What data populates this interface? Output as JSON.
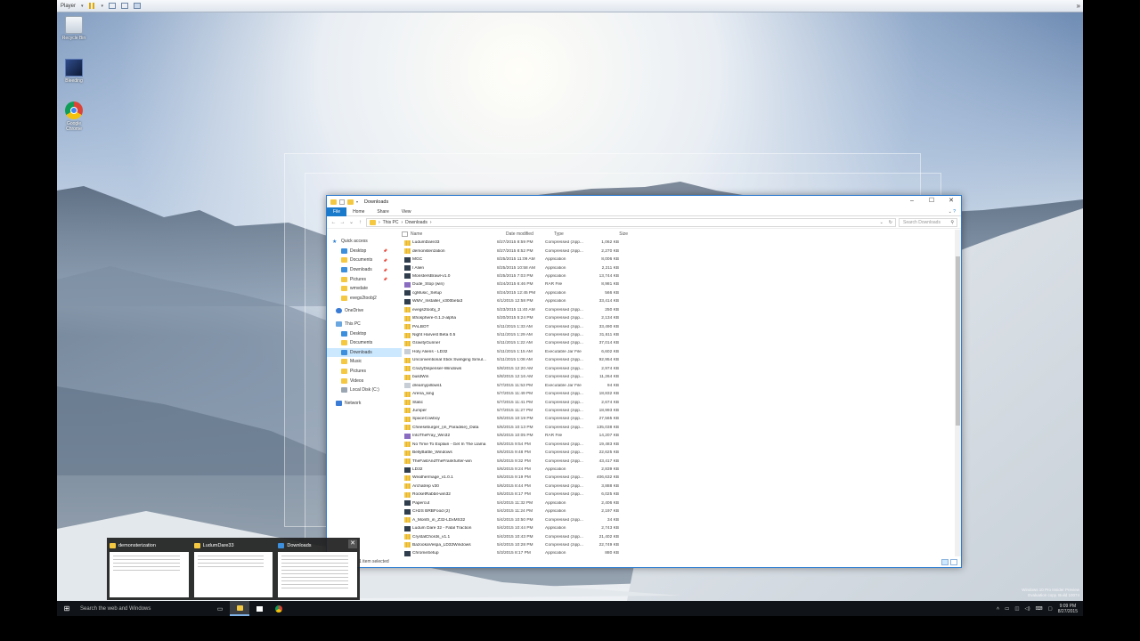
{
  "player": {
    "label": "Player"
  },
  "desktop": {
    "icons": [
      {
        "label": "Recycle Bin"
      },
      {
        "label": "Bleeding"
      },
      {
        "label": "Google Chrome"
      }
    ],
    "watermark": [
      "Windows 10 Pro Insider Preview",
      "Evaluation copy. Build 10074"
    ]
  },
  "explorer": {
    "title": "Downloads",
    "ribbon": {
      "tabs": [
        "File",
        "Home",
        "Share",
        "View"
      ]
    },
    "address": {
      "crumbs": [
        "This PC",
        "Downloads"
      ],
      "search_placeholder": "Search Downloads"
    },
    "nav": {
      "quick_access": "Quick access",
      "pinned": [
        "Desktop",
        "Documents",
        "Downloads",
        "Pictures"
      ],
      "recent": [
        "wmvdate",
        "evegs2toobj2"
      ],
      "onedrive": "OneDrive",
      "this_pc": "This PC",
      "pc_items": [
        "Desktop",
        "Documents",
        "Downloads",
        "Music",
        "Pictures",
        "Videos",
        "Local Disk (C:)"
      ],
      "network": "Network"
    },
    "columns": {
      "name": "Name",
      "date": "Date modified",
      "type": "Type",
      "size": "Size"
    },
    "files": [
      {
        "name": "LudumDare33",
        "date": "8/27/2015 8:59 PM",
        "type": "Compressed (zipp...",
        "size": "1,062 KB",
        "icon": "zip"
      },
      {
        "name": "demonsterization",
        "date": "8/27/2015 8:52 PM",
        "type": "Compressed (zipp...",
        "size": "2,270 KB",
        "icon": "zip"
      },
      {
        "name": "MGC",
        "date": "8/25/2015 11:09 AM",
        "type": "Application",
        "size": "8,006 KB",
        "icon": "exe"
      },
      {
        "name": "I Alien",
        "date": "8/25/2015 10:58 AM",
        "type": "Application",
        "size": "2,211 KB",
        "icon": "exe"
      },
      {
        "name": "MonstersBrawl-v1.0",
        "date": "8/25/2015 7:03 PM",
        "type": "Application",
        "size": "13,744 KB",
        "icon": "exe"
      },
      {
        "name": "Dude_Stop (win)",
        "date": "8/24/2015 6:46 PM",
        "type": "RAR File",
        "size": "8,981 KB",
        "icon": "rar"
      },
      {
        "name": "cgMusic_Setup",
        "date": "8/24/2015 12:45 PM",
        "type": "Application",
        "size": "566 KB",
        "icon": "exe"
      },
      {
        "name": "WMV_Installer_v300beta3",
        "date": "6/1/2015 12:58 PM",
        "type": "Application",
        "size": "33,414 KB",
        "icon": "exe"
      },
      {
        "name": "evegs2toobj_2",
        "date": "5/23/2015 11:40 AM",
        "type": "Compressed (zipp...",
        "size": "250 KB",
        "icon": "zip"
      },
      {
        "name": "lithosphere-0.1.2-alpha",
        "date": "5/20/2015 5:24 PM",
        "type": "Compressed (zipp...",
        "size": "2,134 KB",
        "icon": "zip"
      },
      {
        "name": "PALBOT",
        "date": "5/11/2015 1:33 AM",
        "type": "Compressed (zipp...",
        "size": "33,490 KB",
        "icon": "zip"
      },
      {
        "name": "Night Harvest Beta 0.5",
        "date": "5/11/2015 1:29 AM",
        "type": "Compressed (zipp...",
        "size": "31,611 KB",
        "icon": "zip"
      },
      {
        "name": "GravityGunner",
        "date": "5/11/2015 1:22 AM",
        "type": "Compressed (zipp...",
        "size": "37,014 KB",
        "icon": "zip"
      },
      {
        "name": "Holy Aliens - LD32",
        "date": "5/11/2015 1:15 AM",
        "type": "Executable Jar File",
        "size": "6,602 KB",
        "icon": "jar"
      },
      {
        "name": "Unconventional Stick Swinging Simul...",
        "date": "5/11/2015 1:08 AM",
        "type": "Compressed (zipp...",
        "size": "92,954 KB",
        "icon": "zip"
      },
      {
        "name": "CrazyDispenser-Windows",
        "date": "5/8/2015 12:20 AM",
        "type": "Compressed (zipp...",
        "size": "2,974 KB",
        "icon": "zip"
      },
      {
        "name": "buildWin",
        "date": "5/8/2015 12:16 AM",
        "type": "Compressed (zipp...",
        "size": "11,264 KB",
        "icon": "zip"
      },
      {
        "name": "dreamypillows1",
        "date": "5/7/2015 11:53 PM",
        "type": "Executable Jar File",
        "size": "94 KB",
        "icon": "jar"
      },
      {
        "name": "Arena_king",
        "date": "5/7/2015 11:49 PM",
        "type": "Compressed (zipp...",
        "size": "18,832 KB",
        "icon": "zip"
      },
      {
        "name": "Static",
        "date": "5/7/2015 11:41 PM",
        "type": "Compressed (zipp...",
        "size": "2,674 KB",
        "icon": "zip"
      },
      {
        "name": "Jumper",
        "date": "5/7/2015 11:27 PM",
        "type": "Compressed (zipp...",
        "size": "18,993 KB",
        "icon": "zip"
      },
      {
        "name": "SpaceCowboy",
        "date": "5/6/2015 10:19 PM",
        "type": "Compressed (zipp...",
        "size": "27,565 KB",
        "icon": "zip"
      },
      {
        "name": "Cheeseburger_(in_Paradise)_Data",
        "date": "5/6/2015 10:13 PM",
        "type": "Compressed (zipp...",
        "size": "135,038 KB",
        "icon": "zip"
      },
      {
        "name": "IntoTheFray_Win32",
        "date": "5/6/2015 10:05 PM",
        "type": "RAR File",
        "size": "14,207 KB",
        "icon": "rar"
      },
      {
        "name": "No Time To Explain - Get In The Llama",
        "date": "5/6/2015 9:54 PM",
        "type": "Compressed (zipp...",
        "size": "19,483 KB",
        "icon": "zip"
      },
      {
        "name": "BellyBattle_Windows",
        "date": "5/6/2015 9:48 PM",
        "type": "Compressed (zipp...",
        "size": "22,625 KB",
        "icon": "zip"
      },
      {
        "name": "TheFastAndTheFrankfurter-win",
        "date": "5/6/2015 9:32 PM",
        "type": "Compressed (zipp...",
        "size": "43,417 KB",
        "icon": "zip"
      },
      {
        "name": "LD32",
        "date": "5/6/2015 9:24 PM",
        "type": "Application",
        "size": "2,839 KB",
        "icon": "exe"
      },
      {
        "name": "Weathermage_v1.0.1",
        "date": "5/6/2015 9:19 PM",
        "type": "Compressed (zipp...",
        "size": "406,632 KB",
        "icon": "zip"
      },
      {
        "name": "Archatrep v30",
        "date": "5/6/2015 8:44 PM",
        "type": "Compressed (zipp...",
        "size": "3,888 KB",
        "icon": "zip"
      },
      {
        "name": "RocketRabbit-win32",
        "date": "5/6/2015 8:17 PM",
        "type": "Compressed (zipp...",
        "size": "6,025 KB",
        "icon": "zip"
      },
      {
        "name": "Papercut",
        "date": "5/4/2015 11:32 PM",
        "type": "Application",
        "size": "2,406 KB",
        "icon": "exe"
      },
      {
        "name": "CH2S BRBFood (2)",
        "date": "5/4/2015 11:24 PM",
        "type": "Application",
        "size": "2,197 KB",
        "icon": "exe"
      },
      {
        "name": "A_Month_in_Z32-LDxMS32",
        "date": "5/4/2015 10:50 PM",
        "type": "Compressed (zipp...",
        "size": "34 KB",
        "icon": "zip"
      },
      {
        "name": "Ludum Dare 32 - Fatal Traction",
        "date": "5/4/2015 10:44 PM",
        "type": "Application",
        "size": "2,743 KB",
        "icon": "exe"
      },
      {
        "name": "CrystalChords_v1.1",
        "date": "5/4/2015 10:43 PM",
        "type": "Compressed (zipp...",
        "size": "21,402 KB",
        "icon": "zip"
      },
      {
        "name": "BazookaVespa_LD32Windows",
        "date": "5/4/2015 10:28 PM",
        "type": "Compressed (zipp...",
        "size": "22,749 KB",
        "icon": "zip"
      },
      {
        "name": "ChromeSetup",
        "date": "5/3/2015 8:17 PM",
        "type": "Application",
        "size": "880 KB",
        "icon": "exe"
      }
    ],
    "status": "1 item selected"
  },
  "thumbnails": [
    {
      "title": "demonsterization"
    },
    {
      "title": "LudumDare33"
    },
    {
      "title": "Downloads"
    }
  ],
  "taskbar": {
    "search_placeholder": "Search the web and Windows",
    "time": "9:09 PM",
    "date": "8/27/2015"
  }
}
